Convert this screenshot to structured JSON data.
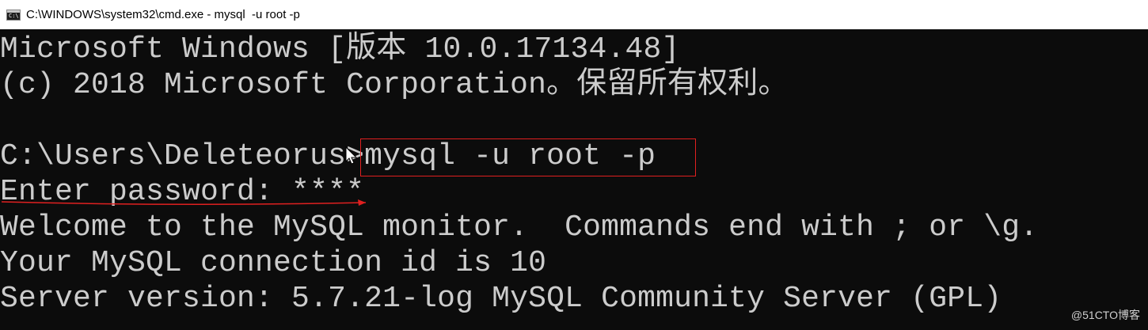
{
  "window": {
    "title": "C:\\WINDOWS\\system32\\cmd.exe - mysql  -u root -p",
    "icon": "cmd-icon",
    "icon_glyph": "C:\\"
  },
  "console": {
    "lines": [
      "Microsoft Windows [版本 10.0.17134.48]",
      "(c) 2018 Microsoft Corporation。保留所有权利。",
      "",
      "C:\\Users\\Deleteorus>mysql -u root -p",
      "Enter password: ****",
      "Welcome to the MySQL monitor.  Commands end with ; or \\g.",
      "Your MySQL connection id is 10",
      "Server version: 5.7.21-log MySQL Community Server (GPL)"
    ],
    "text_color": "#cccccc",
    "background_color": "#0c0c0c"
  },
  "annotations": {
    "highlight_color": "#e02020",
    "cursor_icon": "mouse-pointer-icon"
  },
  "watermark": {
    "text": "@51CTO博客"
  }
}
